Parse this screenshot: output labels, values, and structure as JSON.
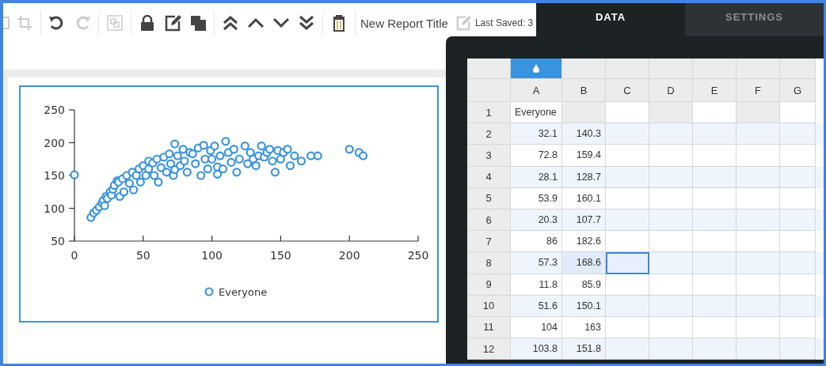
{
  "toolbar": [
    {
      "kind": "partial",
      "disabled": true
    },
    {
      "kind": "crop",
      "disabled": true
    },
    {
      "kind": "undo",
      "disabled": false
    },
    {
      "kind": "redo",
      "disabled": true
    },
    {
      "kind": "group",
      "disabled": true
    },
    {
      "kind": "lock",
      "disabled": false
    },
    {
      "kind": "edit",
      "disabled": false
    },
    {
      "kind": "copy",
      "disabled": false
    },
    {
      "kind": "top",
      "disabled": false
    },
    {
      "kind": "up",
      "disabled": false
    },
    {
      "kind": "down",
      "disabled": false
    },
    {
      "kind": "bottom",
      "disabled": false
    },
    {
      "kind": "trash",
      "disabled": false
    }
  ],
  "report_title": "New Report Title",
  "rename_disabled": true,
  "last_saved": "Last Saved: 3",
  "tabs": [
    {
      "label": "DATA",
      "selected": true
    },
    {
      "label": "SETTINGS",
      "selected": false
    }
  ],
  "chart": {
    "chart_data": {
      "type": "scatter",
      "xlim": [
        0,
        250
      ],
      "ylim": [
        50,
        250
      ],
      "xticks": [
        0,
        50,
        100,
        150,
        200,
        250
      ],
      "yticks": [
        50,
        100,
        150,
        200,
        250
      ],
      "x": [
        0,
        12,
        14,
        16,
        18,
        20,
        21,
        22,
        23,
        24,
        26,
        27,
        28,
        29,
        31,
        32,
        33,
        35,
        36,
        38,
        40,
        42,
        43,
        45,
        47,
        48,
        50,
        52,
        54,
        54,
        57,
        58,
        60,
        61,
        63,
        65,
        67,
        69,
        70,
        72,
        73,
        73,
        75,
        77,
        79,
        80,
        82,
        84,
        86,
        88,
        90,
        92,
        94,
        95,
        97,
        99,
        100,
        102,
        104,
        104,
        106,
        108,
        110,
        112,
        114,
        116,
        118,
        120,
        124,
        126,
        128,
        130,
        132,
        134,
        136,
        138,
        140,
        142,
        144,
        146,
        148,
        150,
        152,
        155,
        157,
        160,
        165,
        172,
        177,
        200,
        207,
        210
      ],
      "series": [
        {
          "name": "Everyone",
          "color": "#3a93dd",
          "values": [
            151,
            86,
            93,
            97,
            102,
            108,
            112,
            104,
            118,
            115,
            125,
            120,
            129,
            135,
            142,
            140,
            118,
            145,
            125,
            150,
            138,
            155,
            128,
            150,
            160,
            140,
            165,
            150,
            172,
            160,
            169,
            150,
            175,
            140,
            162,
            178,
            155,
            183,
            168,
            150,
            159,
            198,
            180,
            165,
            190,
            172,
            155,
            185,
            183,
            168,
            192,
            150,
            196,
            175,
            160,
            188,
            175,
            195,
            163,
            152,
            180,
            160,
            202,
            185,
            170,
            190,
            155,
            175,
            195,
            168,
            185,
            175,
            165,
            180,
            195,
            178,
            185,
            190,
            172,
            155,
            188,
            175,
            185,
            190,
            165,
            180,
            172,
            180,
            180,
            190,
            185,
            180
          ]
        }
      ]
    }
  },
  "grid": {
    "columns": [
      "A",
      "B",
      "C",
      "D",
      "E",
      "F",
      "G"
    ],
    "rows": [
      {
        "number": "1",
        "a": "Everyone",
        "selected": false
      },
      {
        "number": "2",
        "a": "32.1",
        "b": "140.3",
        "selected": false
      },
      {
        "number": "3",
        "a": "72.8",
        "b": "159.4",
        "selected": false
      },
      {
        "number": "4",
        "a": "28.1",
        "b": "128.7",
        "selected": false
      },
      {
        "number": "5",
        "a": "53.9",
        "b": "160.1",
        "selected": false
      },
      {
        "number": "6",
        "a": "20.3",
        "b": "107.7",
        "selected": false
      },
      {
        "number": "7",
        "a": "86",
        "b": "182.6",
        "selected": false
      },
      {
        "number": "8",
        "a": "57.3",
        "b": "168.6",
        "selected": true
      },
      {
        "number": "9",
        "a": "11.8",
        "b": "85.9",
        "selected": false
      },
      {
        "number": "10",
        "a": "51.6",
        "b": "150.1",
        "selected": false
      },
      {
        "number": "11",
        "a": "104",
        "b": "163",
        "selected": false
      },
      {
        "number": "12",
        "a": "103.8",
        "b": "151.8",
        "selected": false
      }
    ]
  }
}
